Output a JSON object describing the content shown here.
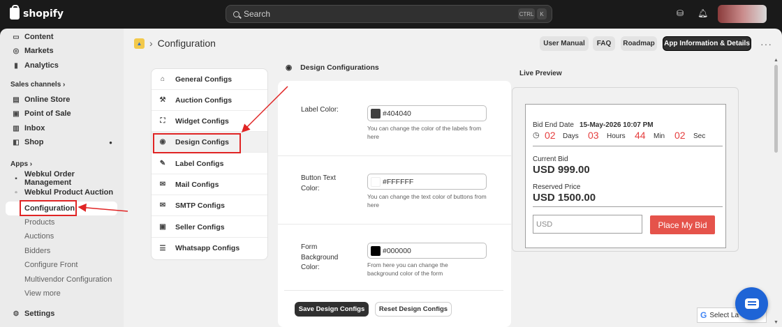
{
  "topbar": {
    "brand": "shopify",
    "search_placeholder": "Search",
    "shortcut_keys": [
      "CTRL",
      "K"
    ]
  },
  "sidebar": {
    "top_items": [
      {
        "label": "Content",
        "icon": "content-icon"
      },
      {
        "label": "Markets",
        "icon": "globe-icon"
      },
      {
        "label": "Analytics",
        "icon": "bar-chart-icon"
      }
    ],
    "sales_channels_label": "Sales channels",
    "sales_channels": [
      {
        "label": "Online Store",
        "icon": "store-icon"
      },
      {
        "label": "Point of Sale",
        "icon": "pos-icon"
      },
      {
        "label": "Inbox",
        "icon": "inbox-icon"
      },
      {
        "label": "Shop",
        "icon": "shop-icon"
      }
    ],
    "apps_label": "Apps",
    "apps": [
      {
        "label": "Webkul Order Management",
        "icon": "app-icon"
      },
      {
        "label": "Webkul Product Auction",
        "icon": "app-icon"
      }
    ],
    "app_subitems": [
      "Configuration",
      "Products",
      "Auctions",
      "Bidders",
      "Configure Front",
      "Multivendor Configuration",
      "View more"
    ],
    "settings_label": "Settings"
  },
  "header": {
    "title": "Configuration",
    "buttons": [
      "User Manual",
      "FAQ",
      "Roadmap",
      "App Information & Details"
    ]
  },
  "config_menu": [
    {
      "label": "General Configs",
      "icon": "home-icon"
    },
    {
      "label": "Auction Configs",
      "icon": "hammer-icon"
    },
    {
      "label": "Widget Configs",
      "icon": "widget-icon"
    },
    {
      "label": "Design Configs",
      "icon": "eye-icon"
    },
    {
      "label": "Label Configs",
      "icon": "label-icon"
    },
    {
      "label": "Mail Configs",
      "icon": "mail-icon"
    },
    {
      "label": "SMTP Configs",
      "icon": "envelope-icon"
    },
    {
      "label": "Seller Configs",
      "icon": "seller-icon"
    },
    {
      "label": "Whatsapp Configs",
      "icon": "sliders-icon"
    }
  ],
  "design": {
    "heading": "Design Configurations",
    "fields": [
      {
        "label": "Label Color:",
        "value": "#404040",
        "swatch": "#404040",
        "help": "You can change the color of the labels from here"
      },
      {
        "label": "Button Text Color:",
        "value": "#FFFFFF",
        "swatch": "#FFFFFF",
        "help": "You can change the text color of buttons from here"
      },
      {
        "label": "Form Background Color:",
        "value": "#000000",
        "swatch": "#000000",
        "help": "From here you can change the background color of the form"
      }
    ],
    "save_label": "Save Design Configs",
    "reset_label": "Reset Design Configs"
  },
  "preview": {
    "title": "Live Preview",
    "bid_end_label": "Bid End Date",
    "bid_end_value": "15-May-2026 10:07 PM",
    "days": "02",
    "days_label": "Days",
    "hours": "03",
    "hours_label": "Hours",
    "mins": "44",
    "mins_label": "Min",
    "secs": "02",
    "secs_label": "Sec",
    "current_bid_label": "Current Bid",
    "current_bid_value": "USD 999.00",
    "reserved_label": "Reserved Price",
    "reserved_value": "USD 1500.00",
    "input_placeholder": "USD",
    "button_label": "Place My Bid"
  },
  "translate_label": "Select La",
  "colors": {
    "accent_red": "#e53e3e",
    "chat_blue": "#1e64d6",
    "annotation_red": "#e02424"
  }
}
